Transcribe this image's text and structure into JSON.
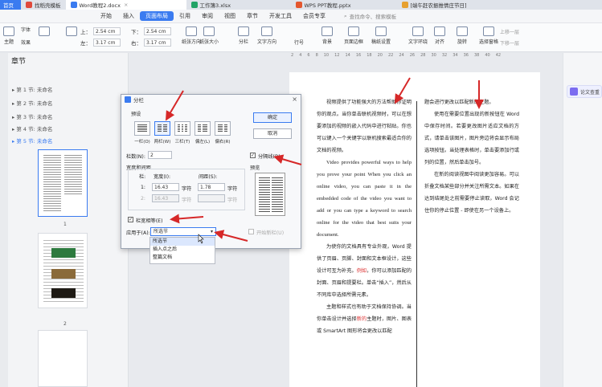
{
  "tabs": [
    {
      "label": "首页",
      "color": "#3a7bf0"
    },
    {
      "label": "找稻壳模板",
      "color": "#e0493b"
    },
    {
      "label": "Word教程2.docx",
      "color": "#3a7bf0"
    },
    {
      "label": "工作簿3.xlsx",
      "color": "#21a366"
    },
    {
      "label": "WPS PPT教程.pptx",
      "color": "#e4572e"
    },
    {
      "label": "[端午赶农振推情庄节日]",
      "color": "#e7a02f"
    }
  ],
  "menu": {
    "items": [
      "开始",
      "插入",
      "页面布局",
      "引用",
      "审阅",
      "视图",
      "章节",
      "开发工具",
      "会员专享"
    ],
    "active": "页面布局",
    "search": "查找命令、搜索模板"
  },
  "ribbon": {
    "top_label": "上：",
    "top_val": "2.54 cm",
    "bottom_label": "下：",
    "bottom_val": "2.54 cm",
    "left_label": "左：",
    "left_val": "3.17 cm",
    "right_label": "右：",
    "right_val": "3.17 cm",
    "buttons": [
      "纸张方向",
      "纸张大小",
      "分栏",
      "文字方向",
      "行号",
      "背景",
      "页面边框",
      "稿纸设置",
      "文字环绕",
      "对齐",
      "旋转",
      "选择窗格"
    ],
    "right_top": "上移一层",
    "right_bottom": "下移一层",
    "left_small": [
      "文字",
      "主题",
      "字体",
      "效果"
    ]
  },
  "ruler": [
    "2",
    "4",
    "6",
    "8",
    "10",
    "12",
    "14",
    "16",
    "18",
    "20",
    "22",
    "24",
    "26",
    "28",
    "30",
    "32",
    "34",
    "36",
    "38",
    "40",
    "42"
  ],
  "nav": {
    "title": "章节",
    "chapters": [
      "第 1 节: 未命名",
      "第 2 节: 未命名",
      "第 3 节: 未命名",
      "第 4 节: 未命名",
      "第 5 节: 未命名"
    ],
    "page_numbers": [
      "1",
      "2"
    ]
  },
  "dialog": {
    "title": "分栏",
    "preset_label": "预设",
    "presets": [
      "一栏(O)",
      "两栏(W)",
      "三栏(T)",
      "偏左(L)",
      "偏右(R)"
    ],
    "ok": "确定",
    "cancel": "取消",
    "columns_label": "栏数(N):",
    "columns_value": "2",
    "separator_label": "分隔线(B)",
    "width_spacing_label": "宽度和间距",
    "col_header": "栏:",
    "width_header": "宽度(I):",
    "spacing_header": "间距(S):",
    "row1_num": "1:",
    "row1_width": "16.43",
    "row1_spacing": "1.78",
    "row2_num": "2:",
    "row2_width": "16.43",
    "unit": "字符",
    "preview_label": "预览",
    "equal_width_label": "栏宽相等(E)",
    "apply_label": "应用于(A):",
    "apply_value": "所选节",
    "new_column_label": "开始新栏(U)",
    "apply_options": [
      "所选节",
      "插入点之后",
      "整篇文档"
    ]
  },
  "document": {
    "left_col": [
      {
        "text": "视频提供了功能强大的方法帮助你证明你的观点。当你单击联机视频时，可以在想要添加的视频的嵌入代码中进行粘贴。你也可以键入一个关键字以联机搜索最适合你的文档的视频。",
        "lang": "zh"
      },
      {
        "text": "Video provides powerful ways to help you prove your point When you click an online video, you can paste it in the embedded code of the video you want to add or you can type a keyword to search online for the video that best suits your document.",
        "lang": "en"
      },
      {
        "text": "为使你的文档具有专业外观，Word 提供了页眉、页脚、封面和文本框设计，这些设计可互为补充。",
        "lang": "zh"
      },
      {
        "text": "例如",
        "lang": "red"
      },
      {
        "text": "，你可以添加匹配的封面、页眉和提要栏。单击“插入”，然后从不同库中选择所需元素。",
        "lang": "zh"
      },
      {
        "text": "主题和样式也有助于文档保持协调。当你单击设计并选择",
        "lang": "zh"
      },
      {
        "text": "新的",
        "lang": "red"
      },
      {
        "text": "主题时，图片、图表或 SmartArt 图形将会更改以匹配",
        "lang": "zh"
      }
    ],
    "right_col": [
      {
        "text": "题会进行更改以匹配新的主题。"
      },
      {
        "text": "使用在需要位置出现的新按钮在 Word 中保存时间。若要更改图片适应文档的方式，请单击该图片，图片旁边将会显示布局选项按钮。当处理表格时，单击要添加行或列的位置，然后单击加号。"
      },
      {
        "text": "在新的阅读视图中阅读更加容易。可以折叠文档某些部分并关注所需文本。如果在达到结尾处之前需要停止读取，Word 会记住你的停止位置 - 即使在另一个设备上。"
      }
    ]
  },
  "rightrail": {
    "ai_label": "论文查重"
  }
}
